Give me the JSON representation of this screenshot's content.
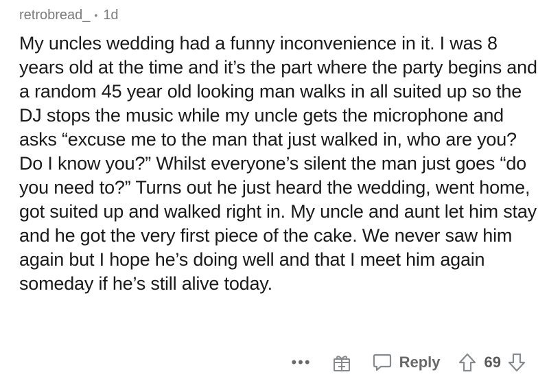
{
  "comment": {
    "author": "retrobread_",
    "separator": "•",
    "age": "1d",
    "text": "My uncles wedding had a funny inconvenience in it. I was 8 years old at the time and it’s the part where the party begins and a random 45 year old looking man walks in all suited up so the DJ stops the music while my uncle gets the microphone and asks “excuse me to the man that just walked in, who are you? Do I know you?” Whilst everyone’s silent the man just goes “do you need to?” Turns out he just heard the wedding, went home, got suited up and walked right in. My uncle and aunt let him stay and he got the very first piece of the cake. We never saw him again but I hope he’s doing well and that I meet him again someday if he’s still alive today."
  },
  "actions": {
    "more_label": "•••",
    "reply_label": "Reply",
    "score": "69",
    "icons": [
      "more-icon",
      "award-icon",
      "reply-icon",
      "upvote-icon",
      "downvote-icon"
    ]
  }
}
